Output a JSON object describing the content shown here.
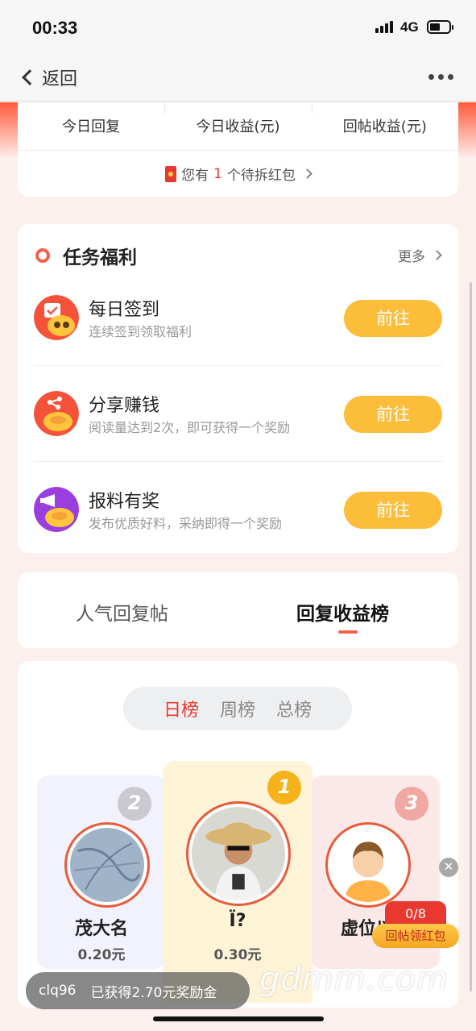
{
  "status_bar": {
    "time": "00:33",
    "network": "4G"
  },
  "nav": {
    "back_label": "返回"
  },
  "stats": {
    "labels": [
      "今日回复",
      "今日收益(元)",
      "回帖收益(元)"
    ],
    "redpacket_prefix": "您有",
    "redpacket_count": "1",
    "redpacket_suffix": "个待拆红包"
  },
  "tasks": {
    "title": "任务福利",
    "more_label": "更多",
    "items": [
      {
        "name": "每日签到",
        "desc": "连续签到领取福利",
        "button": "前往",
        "icon": "daily-checkin-icon"
      },
      {
        "name": "分享赚钱",
        "desc": "阅读量达到2次，即可获得一个奖励",
        "button": "前往",
        "icon": "share-earn-icon"
      },
      {
        "name": "报料有奖",
        "desc": "发布优质好料，采纳即得一个奖励",
        "button": "前往",
        "icon": "report-reward-icon"
      }
    ]
  },
  "tabs": {
    "items": [
      "人气回复帖",
      "回复收益榜"
    ],
    "active_index": 1
  },
  "ranking": {
    "periods": [
      "日榜",
      "周榜",
      "总榜"
    ],
    "active_period": 0,
    "podium": [
      {
        "rank": "2",
        "name": "茂大名",
        "amount": "0.20元"
      },
      {
        "rank": "1",
        "name": "Ï?",
        "amount": "0.30元"
      },
      {
        "rank": "3",
        "name": "虚位以",
        "amount": ""
      }
    ]
  },
  "float_redpacket": {
    "progress": "0/8",
    "label": "回帖领红包"
  },
  "toast": {
    "user": "clq96",
    "message": "已获得2.70元奖励金"
  },
  "watermark": "gdmm.com",
  "colors": {
    "accent": "#f0624f",
    "button": "#fcbe3a",
    "red": "#e8382f"
  }
}
